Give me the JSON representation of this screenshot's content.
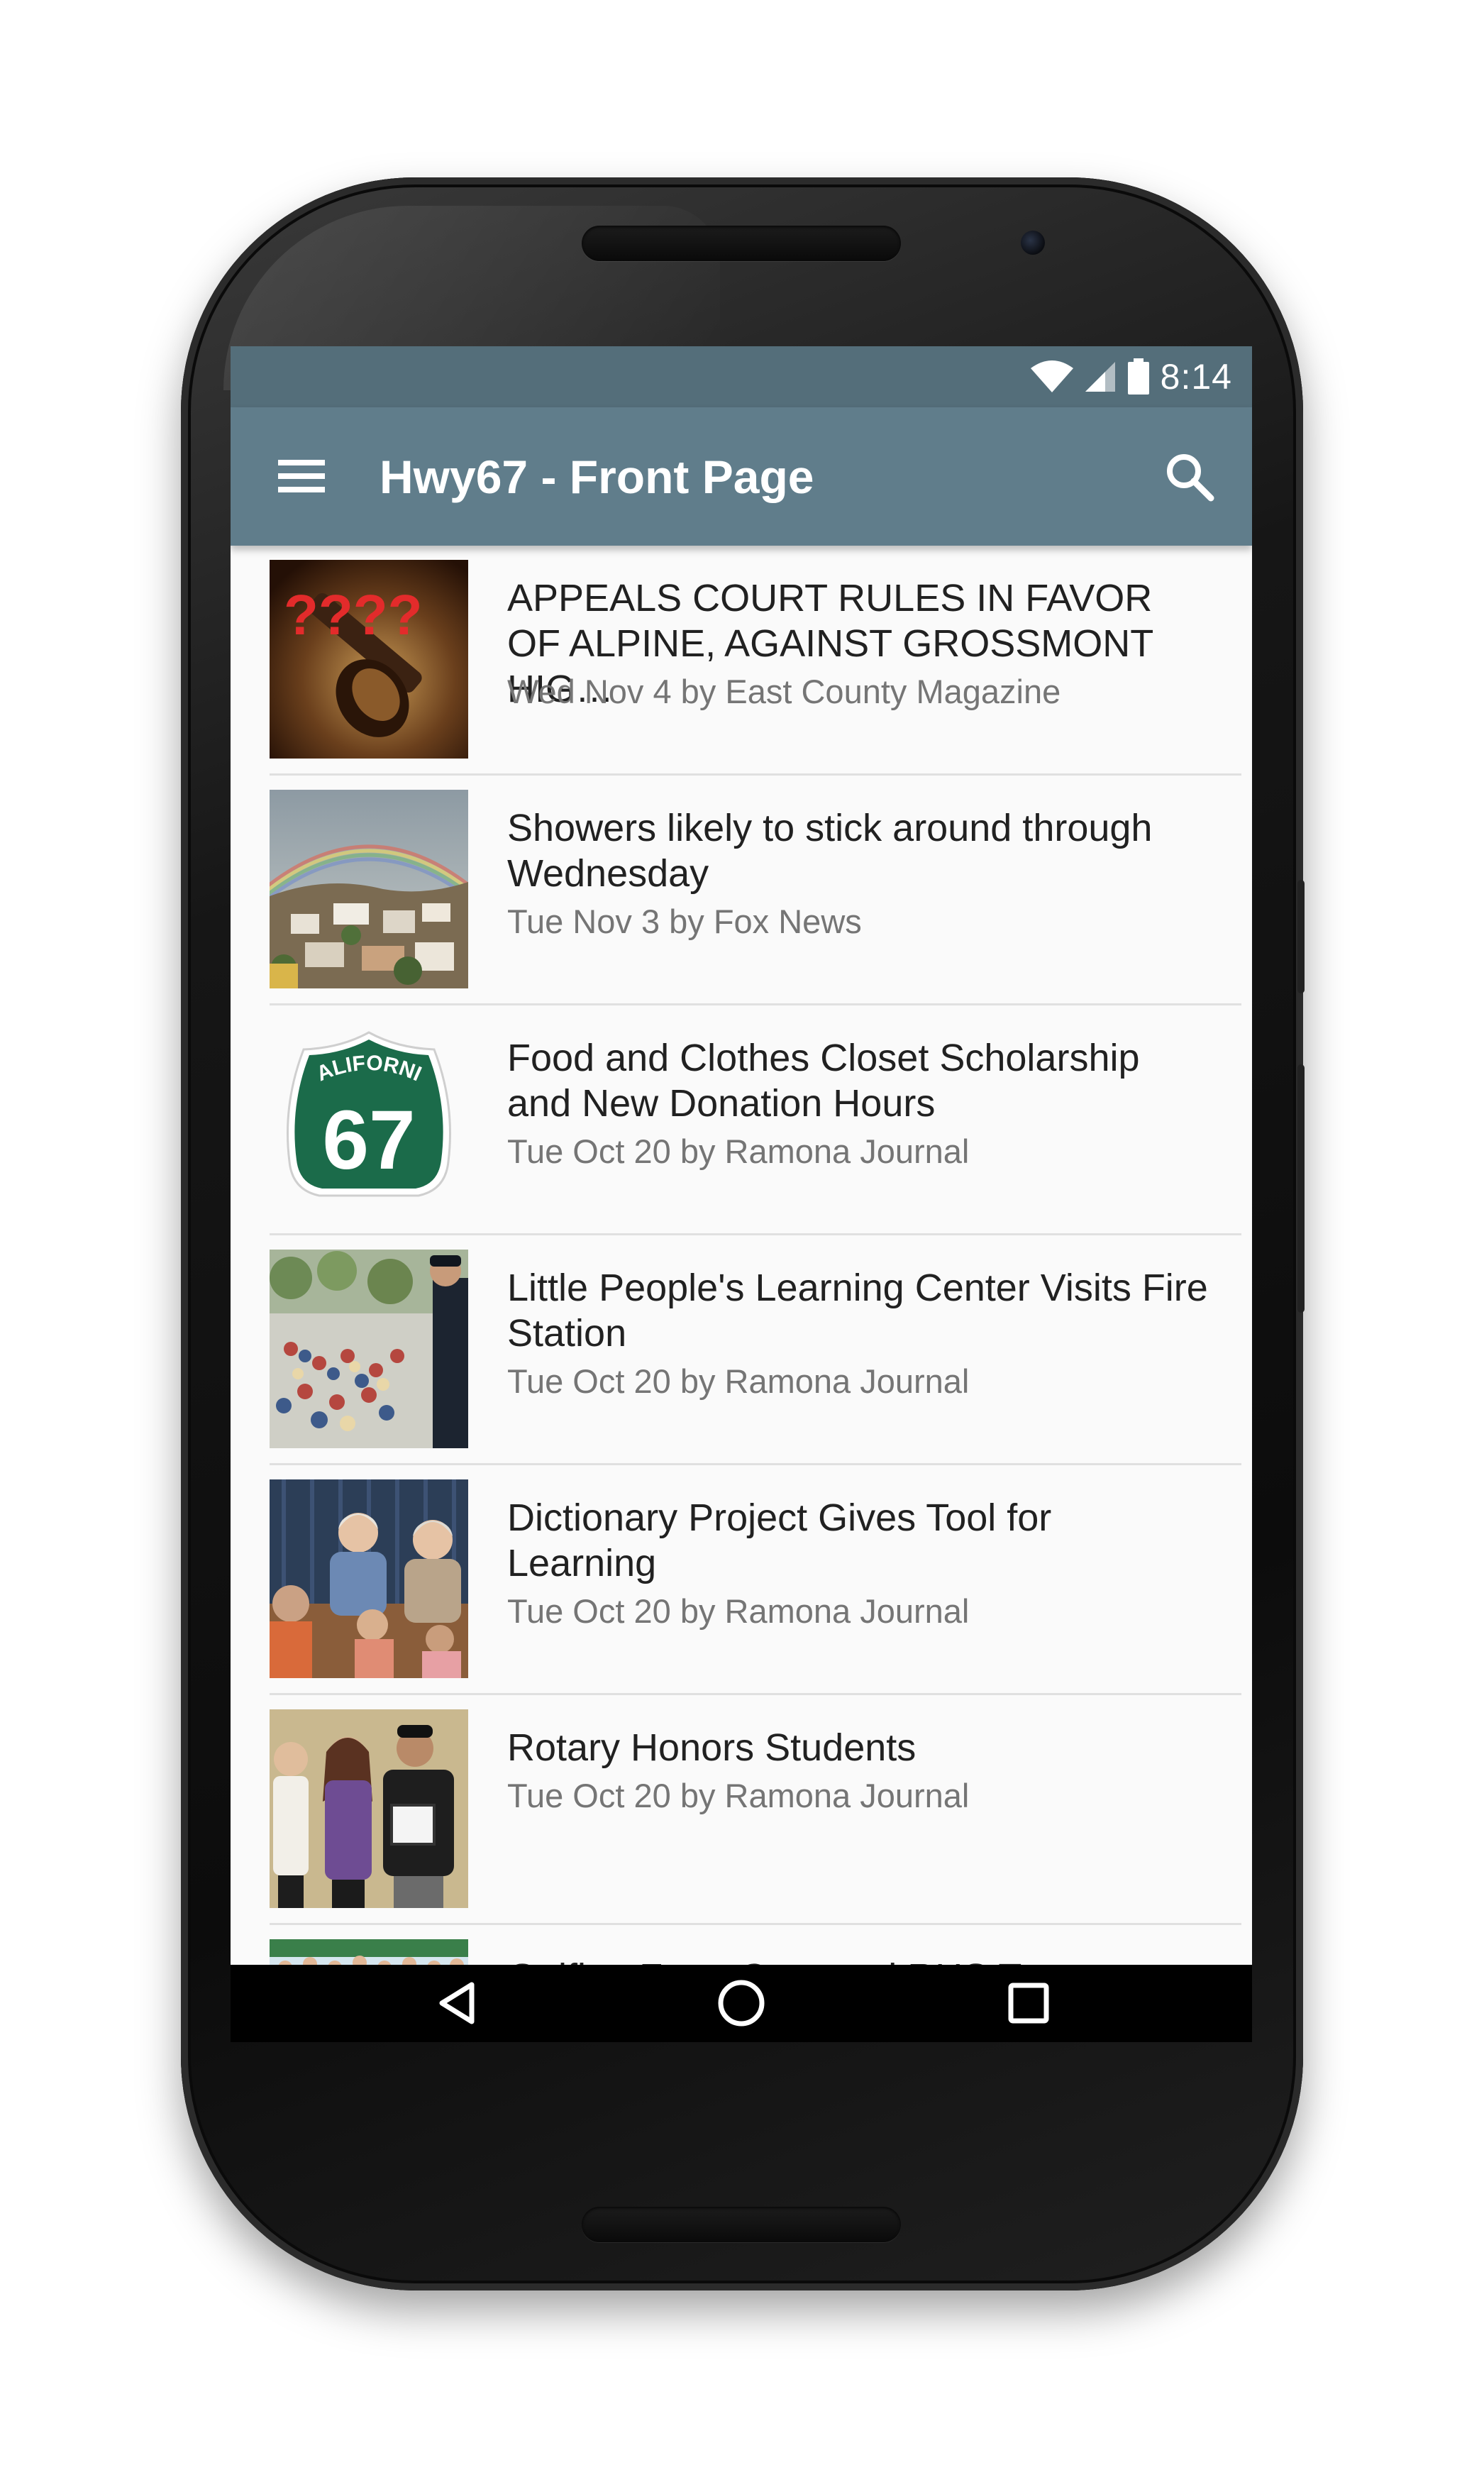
{
  "status_bar": {
    "time": "8:14",
    "icons": [
      "wifi-icon",
      "signal-icon",
      "battery-icon"
    ]
  },
  "app_bar": {
    "title": "Hwy67 - Front Page",
    "menu_icon": "hamburger-menu-icon",
    "search_icon": "search-icon"
  },
  "articles": [
    {
      "title": "APPEALS COURT RULES IN FAVOR OF ALPINE, AGAINST GROSSMONT HIG…",
      "meta": "Wed Nov 4 by East County Magazine",
      "thumb_text": "????"
    },
    {
      "title": "Showers likely to stick around through Wednesday",
      "meta": "Tue Nov 3 by Fox News"
    },
    {
      "title": "Food and Clothes Closet Scholarship and New Donation Hours",
      "meta": "Tue Oct 20 by Ramona Journal",
      "thumb_text": "CALIFORNIA",
      "thumb_number": "67"
    },
    {
      "title": "Little People's Learning Center Visits Fire Station",
      "meta": "Tue Oct 20 by Ramona Journal"
    },
    {
      "title": "Dictionary Project Gives Tool for Learning",
      "meta": "Tue Oct 20 by Ramona Journal"
    },
    {
      "title": "Rotary Honors Students",
      "meta": "Tue Oct 20 by Ramona Journal"
    },
    {
      "title": "Golfing For a Cure and RHS Tournament",
      "meta": ""
    }
  ],
  "nav_bar": {
    "back_icon": "back-triangle-icon",
    "home_icon": "home-circle-icon",
    "recents_icon": "recents-square-icon"
  },
  "colors": {
    "status_bar": "#546e7a",
    "app_bar": "#607d8b",
    "list_background": "#fafafa",
    "title_text": "#212121",
    "meta_text": "#757575",
    "route_shield": "#1b6b4a"
  }
}
